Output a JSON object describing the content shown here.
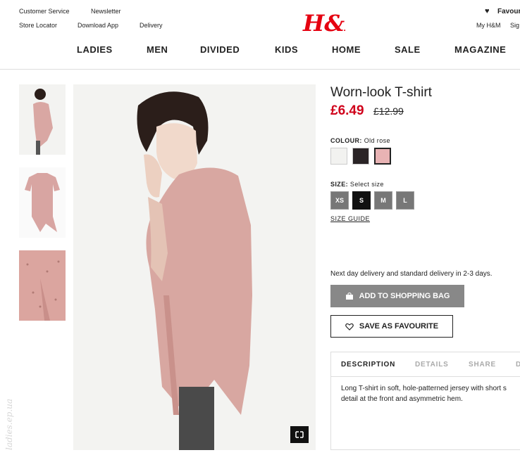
{
  "header": {
    "utility_left": [
      "Customer Service",
      "Newsletter",
      "Store Locator",
      "Download App",
      "Delivery"
    ],
    "favourites_label": "Favour",
    "my_account": "My H&M",
    "sign": "Sig",
    "logo_text": "H&M",
    "nav": [
      "LADIES",
      "MEN",
      "DIVIDED",
      "KIDS",
      "HOME",
      "SALE",
      "MAGAZINE"
    ]
  },
  "product": {
    "title": "Worn-look T-shirt",
    "price": "£6.49",
    "old_price": "£12.99",
    "colour_label": "COLOUR:",
    "colour_value": "Old rose",
    "colours": [
      "#f2f2f0",
      "#2a2426",
      "#e8b3b4"
    ],
    "size_label": "SIZE:",
    "size_value": "Select size",
    "sizes": [
      "XS",
      "S",
      "M",
      "L"
    ],
    "size_guide": "SIZE GUIDE",
    "delivery_note": "Next day delivery and standard delivery in 2-3 days.",
    "add_to_bag": "ADD TO SHOPPING BAG",
    "save_favourite": "SAVE AS FAVOURITE",
    "tabs": [
      "DESCRIPTION",
      "DETAILS",
      "SHARE",
      "D"
    ],
    "description_lines": [
      "Long T-shirt in soft, hole-patterned jersey with short s",
      "detail at the front and asymmetric hem."
    ]
  },
  "watermark": "ladies.ep.ua",
  "colors": {
    "brand": "#e50010",
    "price": "#d0021b"
  }
}
